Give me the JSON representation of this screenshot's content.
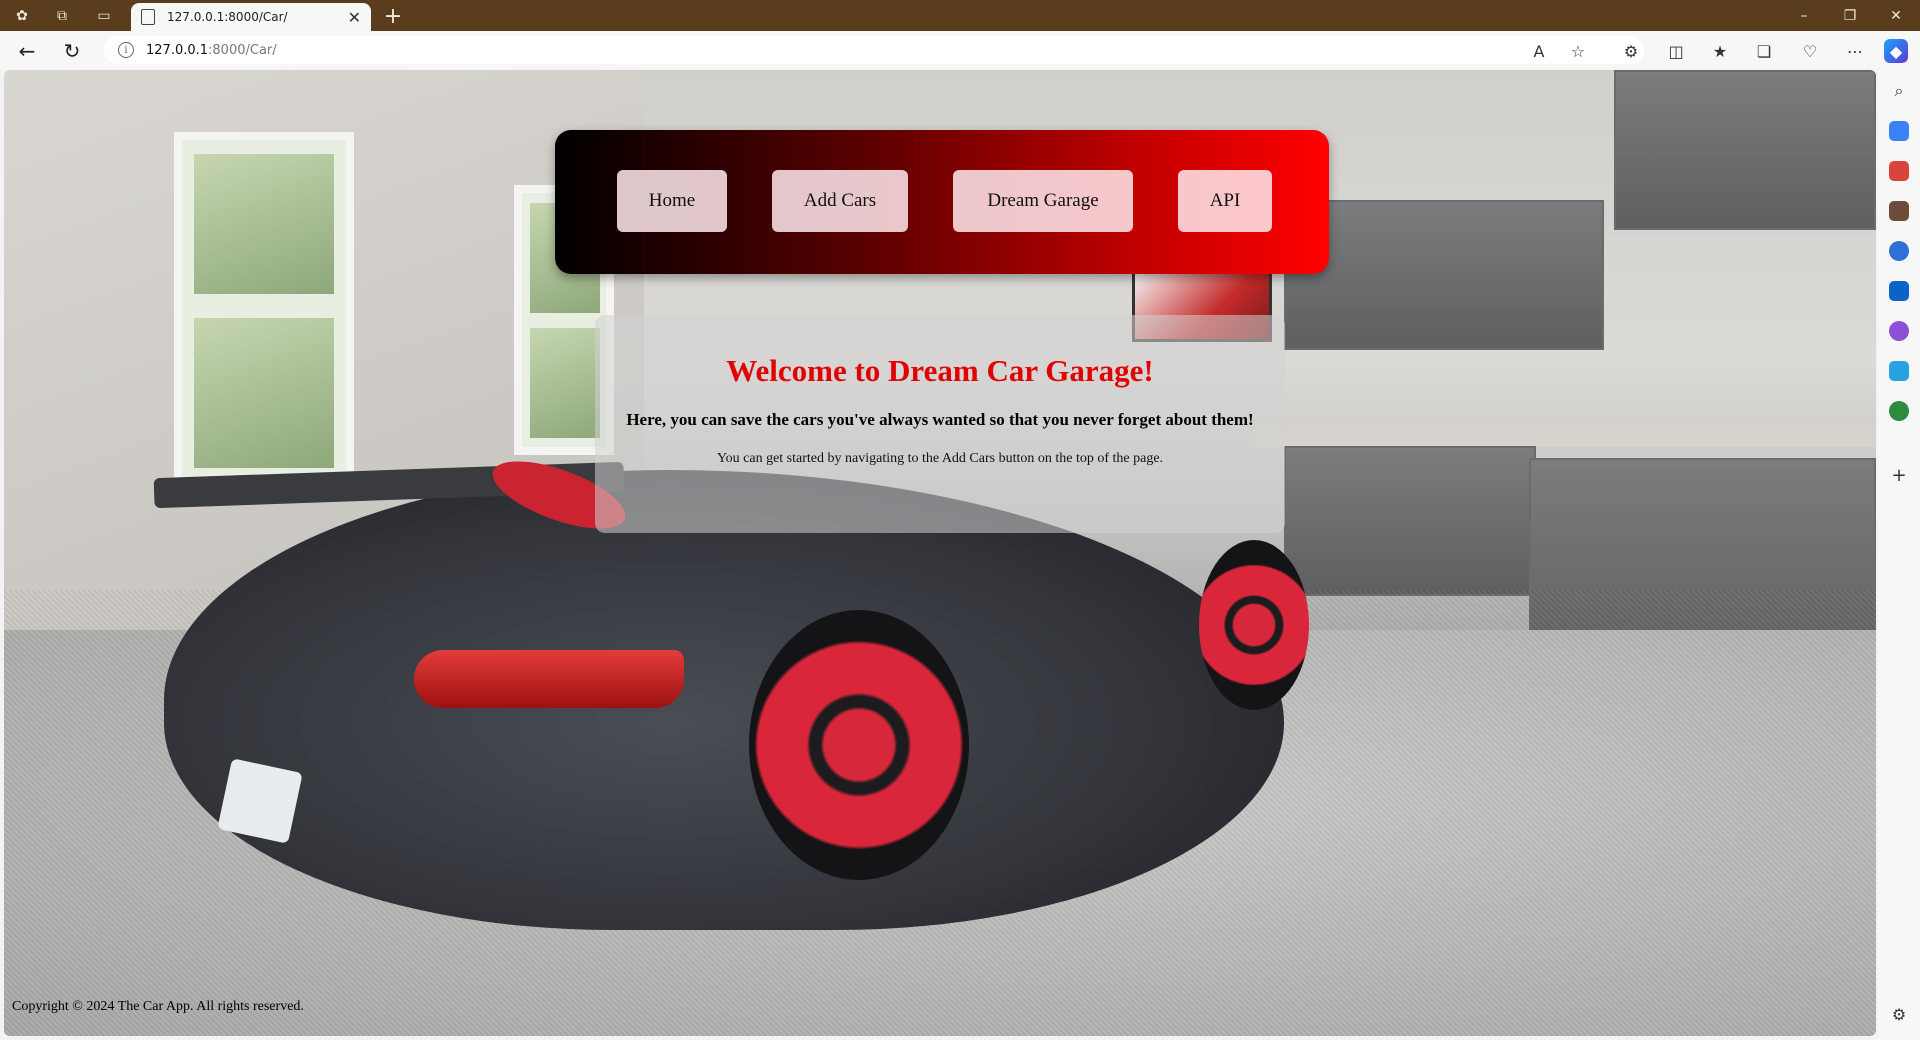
{
  "browser": {
    "tab_title": "127.0.0.1:8000/Car/",
    "tab_close": "✕",
    "new_tab": "+",
    "url_host": "127.0.0.1",
    "url_path": ":8000/Car/",
    "window_controls": [
      "–",
      "❐",
      "✕"
    ]
  },
  "nav": {
    "home": "Home",
    "add_cars": "Add Cars",
    "dream_garage": "Dream Garage",
    "api": "API"
  },
  "welcome": {
    "title": "Welcome to Dream Car Garage!",
    "subtitle": "Here, you can save the cars you've always wanted so that you never forget about them!",
    "body": "You can get started by navigating to the Add Cars button on the top of the page."
  },
  "footer": {
    "text": "Copyright © 2024 The Car App. All rights reserved."
  },
  "colors": {
    "titlebar": "#5a3d1c",
    "welcome_title": "#e00000",
    "nav_gradient_start": "#000000",
    "nav_gradient_end": "#ff0000"
  }
}
